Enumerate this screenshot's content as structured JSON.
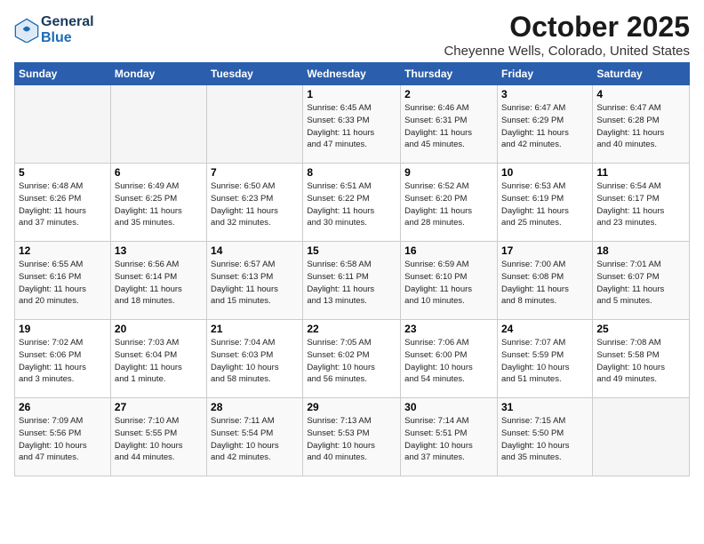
{
  "header": {
    "logo_line1": "General",
    "logo_line2": "Blue",
    "month": "October 2025",
    "location": "Cheyenne Wells, Colorado, United States"
  },
  "weekdays": [
    "Sunday",
    "Monday",
    "Tuesday",
    "Wednesday",
    "Thursday",
    "Friday",
    "Saturday"
  ],
  "weeks": [
    [
      {
        "day": "",
        "info": ""
      },
      {
        "day": "",
        "info": ""
      },
      {
        "day": "",
        "info": ""
      },
      {
        "day": "1",
        "info": "Sunrise: 6:45 AM\nSunset: 6:33 PM\nDaylight: 11 hours\nand 47 minutes."
      },
      {
        "day": "2",
        "info": "Sunrise: 6:46 AM\nSunset: 6:31 PM\nDaylight: 11 hours\nand 45 minutes."
      },
      {
        "day": "3",
        "info": "Sunrise: 6:47 AM\nSunset: 6:29 PM\nDaylight: 11 hours\nand 42 minutes."
      },
      {
        "day": "4",
        "info": "Sunrise: 6:47 AM\nSunset: 6:28 PM\nDaylight: 11 hours\nand 40 minutes."
      }
    ],
    [
      {
        "day": "5",
        "info": "Sunrise: 6:48 AM\nSunset: 6:26 PM\nDaylight: 11 hours\nand 37 minutes."
      },
      {
        "day": "6",
        "info": "Sunrise: 6:49 AM\nSunset: 6:25 PM\nDaylight: 11 hours\nand 35 minutes."
      },
      {
        "day": "7",
        "info": "Sunrise: 6:50 AM\nSunset: 6:23 PM\nDaylight: 11 hours\nand 32 minutes."
      },
      {
        "day": "8",
        "info": "Sunrise: 6:51 AM\nSunset: 6:22 PM\nDaylight: 11 hours\nand 30 minutes."
      },
      {
        "day": "9",
        "info": "Sunrise: 6:52 AM\nSunset: 6:20 PM\nDaylight: 11 hours\nand 28 minutes."
      },
      {
        "day": "10",
        "info": "Sunrise: 6:53 AM\nSunset: 6:19 PM\nDaylight: 11 hours\nand 25 minutes."
      },
      {
        "day": "11",
        "info": "Sunrise: 6:54 AM\nSunset: 6:17 PM\nDaylight: 11 hours\nand 23 minutes."
      }
    ],
    [
      {
        "day": "12",
        "info": "Sunrise: 6:55 AM\nSunset: 6:16 PM\nDaylight: 11 hours\nand 20 minutes."
      },
      {
        "day": "13",
        "info": "Sunrise: 6:56 AM\nSunset: 6:14 PM\nDaylight: 11 hours\nand 18 minutes."
      },
      {
        "day": "14",
        "info": "Sunrise: 6:57 AM\nSunset: 6:13 PM\nDaylight: 11 hours\nand 15 minutes."
      },
      {
        "day": "15",
        "info": "Sunrise: 6:58 AM\nSunset: 6:11 PM\nDaylight: 11 hours\nand 13 minutes."
      },
      {
        "day": "16",
        "info": "Sunrise: 6:59 AM\nSunset: 6:10 PM\nDaylight: 11 hours\nand 10 minutes."
      },
      {
        "day": "17",
        "info": "Sunrise: 7:00 AM\nSunset: 6:08 PM\nDaylight: 11 hours\nand 8 minutes."
      },
      {
        "day": "18",
        "info": "Sunrise: 7:01 AM\nSunset: 6:07 PM\nDaylight: 11 hours\nand 5 minutes."
      }
    ],
    [
      {
        "day": "19",
        "info": "Sunrise: 7:02 AM\nSunset: 6:06 PM\nDaylight: 11 hours\nand 3 minutes."
      },
      {
        "day": "20",
        "info": "Sunrise: 7:03 AM\nSunset: 6:04 PM\nDaylight: 11 hours\nand 1 minute."
      },
      {
        "day": "21",
        "info": "Sunrise: 7:04 AM\nSunset: 6:03 PM\nDaylight: 10 hours\nand 58 minutes."
      },
      {
        "day": "22",
        "info": "Sunrise: 7:05 AM\nSunset: 6:02 PM\nDaylight: 10 hours\nand 56 minutes."
      },
      {
        "day": "23",
        "info": "Sunrise: 7:06 AM\nSunset: 6:00 PM\nDaylight: 10 hours\nand 54 minutes."
      },
      {
        "day": "24",
        "info": "Sunrise: 7:07 AM\nSunset: 5:59 PM\nDaylight: 10 hours\nand 51 minutes."
      },
      {
        "day": "25",
        "info": "Sunrise: 7:08 AM\nSunset: 5:58 PM\nDaylight: 10 hours\nand 49 minutes."
      }
    ],
    [
      {
        "day": "26",
        "info": "Sunrise: 7:09 AM\nSunset: 5:56 PM\nDaylight: 10 hours\nand 47 minutes."
      },
      {
        "day": "27",
        "info": "Sunrise: 7:10 AM\nSunset: 5:55 PM\nDaylight: 10 hours\nand 44 minutes."
      },
      {
        "day": "28",
        "info": "Sunrise: 7:11 AM\nSunset: 5:54 PM\nDaylight: 10 hours\nand 42 minutes."
      },
      {
        "day": "29",
        "info": "Sunrise: 7:13 AM\nSunset: 5:53 PM\nDaylight: 10 hours\nand 40 minutes."
      },
      {
        "day": "30",
        "info": "Sunrise: 7:14 AM\nSunset: 5:51 PM\nDaylight: 10 hours\nand 37 minutes."
      },
      {
        "day": "31",
        "info": "Sunrise: 7:15 AM\nSunset: 5:50 PM\nDaylight: 10 hours\nand 35 minutes."
      },
      {
        "day": "",
        "info": ""
      }
    ]
  ]
}
